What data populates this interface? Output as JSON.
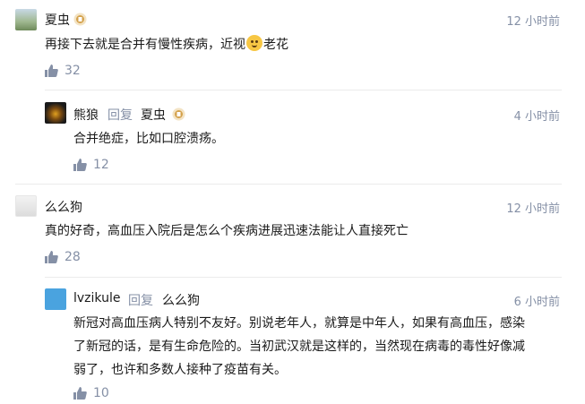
{
  "comments": [
    {
      "author": "夏虫",
      "time": "12 小时前",
      "content_parts": [
        "再接下去就是合并有慢性疾病，近视",
        "老花"
      ],
      "likes": "32",
      "replies": [
        {
          "author": "熊狼",
          "reply_label": "回复",
          "reply_to": "夏虫",
          "time": "4 小时前",
          "content": "合并绝症，比如口腔溃疡。",
          "likes": "12"
        }
      ]
    },
    {
      "author": "么么狗",
      "time": "12 小时前",
      "content": "真的好奇，高血压入院后是怎么个疾病进展迅速法能让人直接死亡",
      "likes": "28",
      "replies": [
        {
          "author": "lvzikule",
          "reply_label": "回复",
          "reply_to": "么么狗",
          "time": "6 小时前",
          "content_lines": [
            "新冠对高血压病人特别不友好。别说老年人，就算是中年人，如果有高血压，感染",
            "了新冠的话，是有生命危险的。当初武汉就是这样的，当然现在病毒的毒性好像减",
            "弱了，也许和多数人接种了疫苗有关。"
          ],
          "likes": "10"
        }
      ]
    }
  ],
  "colors": {
    "meta": "#8590a6",
    "text": "#1a1a1a",
    "divider": "#ebebeb"
  },
  "icons": {
    "like": "thumb-up-icon",
    "badge": "member-badge-icon",
    "emoji": "smile-emoji-icon"
  }
}
